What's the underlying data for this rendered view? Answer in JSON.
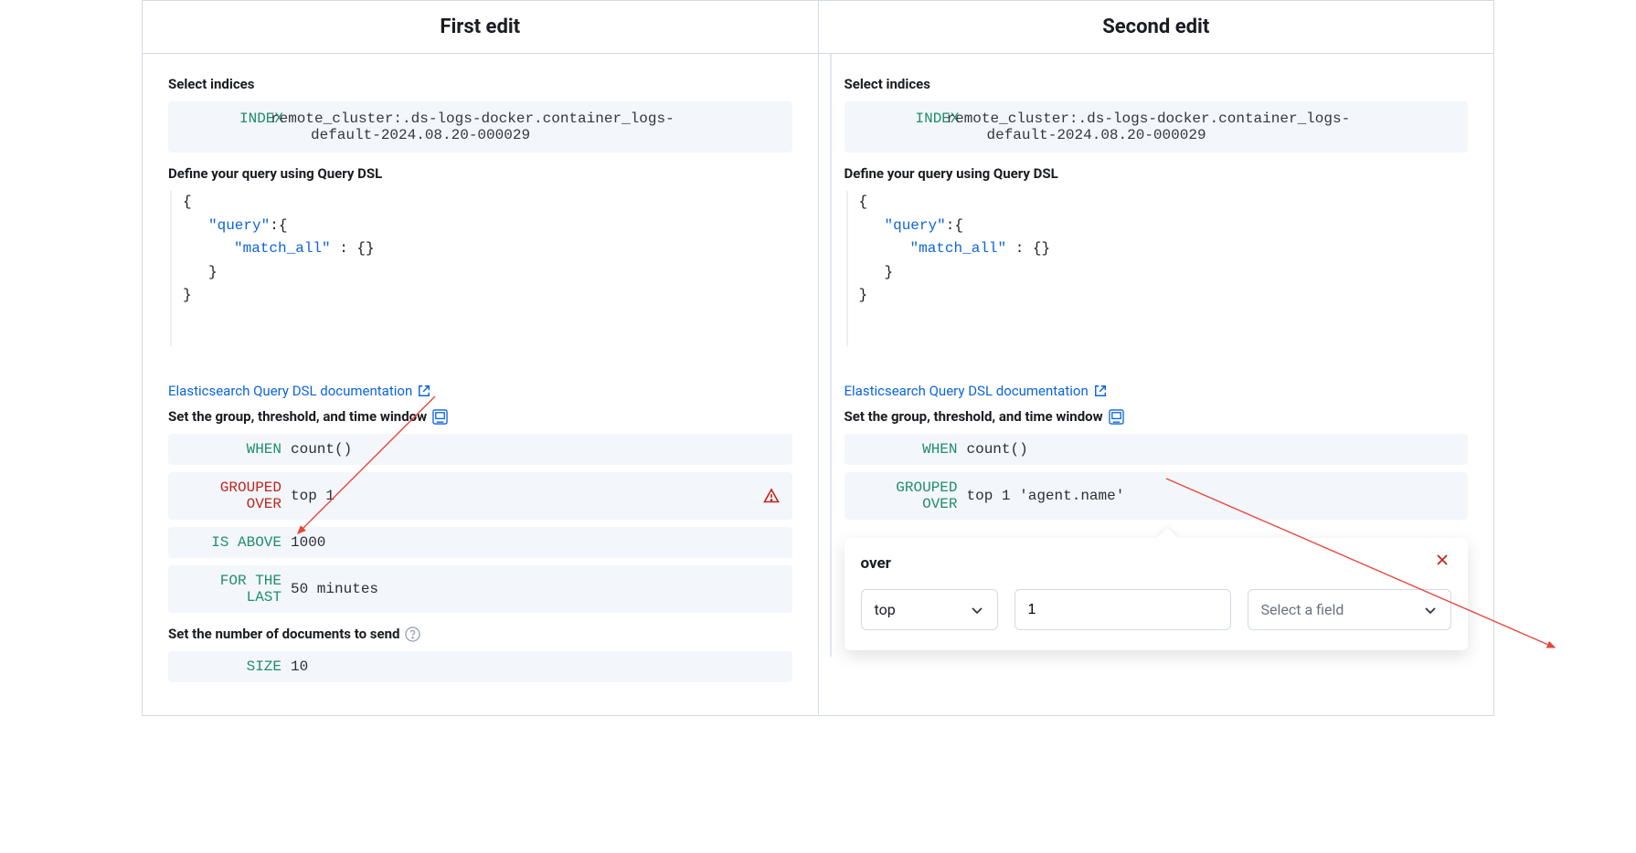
{
  "headers": {
    "left": "First edit",
    "right": "Second edit"
  },
  "common": {
    "select_indices": "Select indices",
    "index_kw": "INDEX",
    "index_line1": "remote_cluster:.ds-logs-docker.container_logs-",
    "index_line2": "default-2024.08.20-000029",
    "define_query": "Define your query using Query DSL",
    "code_l1": "{",
    "code_l2a": "\"query\"",
    "code_l2b": ":{",
    "code_l3a": "\"match_all\"",
    "code_l3b": " : {}",
    "code_l4": "}",
    "code_l5": "}",
    "doc_link": "Elasticsearch Query DSL documentation",
    "set_group": "Set the group, threshold, and time window",
    "when_kw": "WHEN",
    "when_val": "count()",
    "grouped_kw": "GROUPED OVER",
    "above_kw": "IS ABOVE",
    "last_kw": "FOR THE LAST",
    "set_docs": "Set the number of documents to send",
    "size_kw": "SIZE"
  },
  "left": {
    "grouped_val": "top 1",
    "above_val": "1000",
    "last_val": "50 minutes",
    "size_val": "10"
  },
  "right": {
    "grouped_val": "top 1 'agent.name'"
  },
  "popover": {
    "title": "over",
    "select_top": "top",
    "num_val": "1",
    "field_placeholder": "Select a field"
  }
}
